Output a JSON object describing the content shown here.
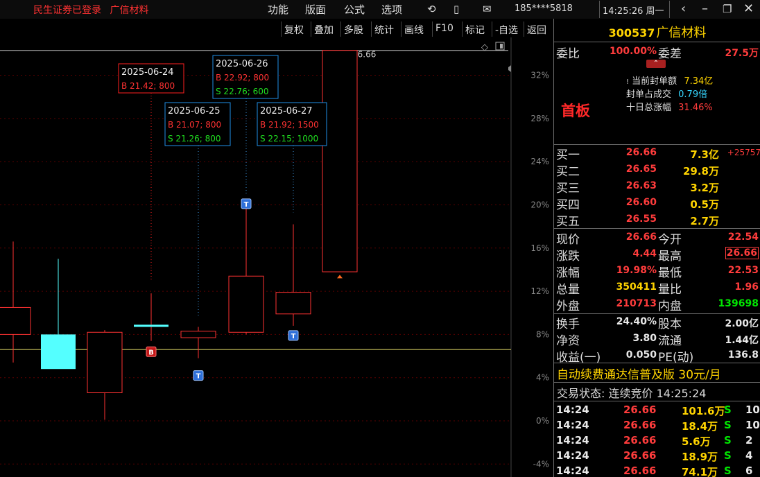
{
  "titlebar": {
    "login_status": "民生证券已登录",
    "stock_name": "广信材料",
    "menus": [
      "功能",
      "版面",
      "公式",
      "选项"
    ],
    "phone": "185****5818",
    "time": "14:25:26 周一",
    "icons": [
      "refresh-icon",
      "phone-icon",
      "mail-icon"
    ]
  },
  "toolbar": {
    "buttons": [
      "复权",
      "叠加",
      "多股",
      "统计",
      "画线",
      "F10",
      "标记",
      "-自选",
      "返回"
    ]
  },
  "chart_data": {
    "type": "candlestick",
    "y_tick_labels": [
      "32%",
      "28%",
      "24%",
      "20%",
      "16%",
      "12%",
      "8%",
      "4%",
      "0%",
      "-4%"
    ],
    "y_ticks": [
      32,
      28,
      24,
      20,
      16,
      12,
      8,
      4,
      0,
      -4
    ],
    "ylim": [
      -5.2,
      35.5
    ],
    "reference_line_pct": 6.6,
    "high_label": "26.66",
    "candles": [
      {
        "open": 8.0,
        "close": 10.5,
        "high": 16.6,
        "low": 5.4,
        "color": "up"
      },
      {
        "open": 8.0,
        "close": 4.8,
        "high": 15.0,
        "low": 4.8,
        "color": "down"
      },
      {
        "open": 2.6,
        "close": 8.2,
        "high": 8.4,
        "low": 0.1,
        "color": "up"
      },
      {
        "open": 8.7,
        "close": 8.9,
        "high": 11.8,
        "low": 7.4,
        "color": "up",
        "doji": true
      },
      {
        "open": 7.7,
        "close": 8.3,
        "high": 8.7,
        "low": 5.8,
        "color": "up"
      },
      {
        "open": 8.2,
        "close": 13.4,
        "high": 20.0,
        "low": 8.0,
        "color": "up"
      },
      {
        "open": 9.9,
        "close": 11.9,
        "high": 18.2,
        "low": 8.8,
        "color": "up"
      },
      {
        "open": 13.8,
        "close": 34.3,
        "high": 34.3,
        "low": 13.8,
        "color": "up"
      }
    ],
    "annotations": [
      {
        "date": "2025-06-24",
        "buy": "B 21.42; 800"
      },
      {
        "date": "2025-06-25",
        "buy": "B 21.07; 800",
        "sell": "S 21.26; 800"
      },
      {
        "date": "2025-06-26",
        "buy": "B 22.92; 800",
        "sell": "S 22.76; 600"
      },
      {
        "date": "2025-06-27",
        "buy": "B 21.92; 1500",
        "sell": "S 22.15; 1000"
      }
    ],
    "markers": [
      {
        "candle": 3,
        "label": "B"
      },
      {
        "candle": 4,
        "label": "T"
      },
      {
        "candle": 5,
        "label": "T"
      },
      {
        "candle": 6,
        "label": "T"
      }
    ]
  },
  "panel": {
    "code": "300537",
    "name": "广信材料",
    "weibi_label": "委比",
    "weibi": "100.00%",
    "weicha_label": "委差",
    "weicha": "27.5万",
    "shouban": "首板",
    "feng": [
      {
        "label": "当前封单额",
        "value": "7.34亿",
        "color": "yellow"
      },
      {
        "label": "封单占成交",
        "value": "0.79倍",
        "color": "cyan"
      },
      {
        "label": "十日总涨幅",
        "value": "31.46%",
        "color": "red"
      }
    ],
    "bids": [
      {
        "label": "买一",
        "price": "26.66",
        "vol": "7.3亿",
        "extra": "+25757"
      },
      {
        "label": "买二",
        "price": "26.65",
        "vol": "29.8万",
        "extra": ""
      },
      {
        "label": "买三",
        "price": "26.63",
        "vol": "3.2万",
        "extra": ""
      },
      {
        "label": "买四",
        "price": "26.60",
        "vol": "0.5万",
        "extra": ""
      },
      {
        "label": "买五",
        "price": "26.55",
        "vol": "2.7万",
        "extra": ""
      }
    ],
    "stats": [
      {
        "l1": "现价",
        "v1": "26.66",
        "c1": "red",
        "l2": "今开",
        "v2": "22.54",
        "c2": "red"
      },
      {
        "l1": "涨跌",
        "v1": "4.44",
        "c1": "red",
        "l2": "最高",
        "v2": "26.66",
        "c2": "red"
      },
      {
        "l1": "涨幅",
        "v1": "19.98%",
        "c1": "red",
        "l2": "最低",
        "v2": "22.53",
        "c2": "red"
      },
      {
        "l1": "总量",
        "v1": "350411",
        "c1": "yellow",
        "l2": "量比",
        "v2": "1.96",
        "c2": "red"
      },
      {
        "l1": "外盘",
        "v1": "210713",
        "c1": "red",
        "l2": "内盘",
        "v2": "139698",
        "c2": "green"
      }
    ],
    "stats2": [
      {
        "l1": "换手",
        "v1": "24.40%",
        "l2": "股本",
        "v2": "2.00亿"
      },
      {
        "l1": "净资",
        "v1": "3.80",
        "l2": "流通",
        "v2": "1.44亿"
      },
      {
        "l1": "收益(一)",
        "v1": "0.050",
        "l2": "PE(动)",
        "v2": "136.8"
      }
    ],
    "promo": "自动续费通达信普及版  30元/月",
    "trade_status": "交易状态: 连续竞价 14:25:24",
    "trades": [
      {
        "time": "14:24",
        "price": "26.66",
        "vol": "101.6万",
        "side": "S",
        "num": "10"
      },
      {
        "time": "14:24",
        "price": "26.66",
        "vol": "18.4万",
        "side": "S",
        "num": "10"
      },
      {
        "time": "14:24",
        "price": "26.66",
        "vol": "5.6万",
        "side": "S",
        "num": "2"
      },
      {
        "time": "14:24",
        "price": "26.66",
        "vol": "18.9万",
        "side": "S",
        "num": "4"
      },
      {
        "time": "14:24",
        "price": "26.66",
        "vol": "74.1万",
        "side": "S",
        "num": "6"
      }
    ]
  }
}
